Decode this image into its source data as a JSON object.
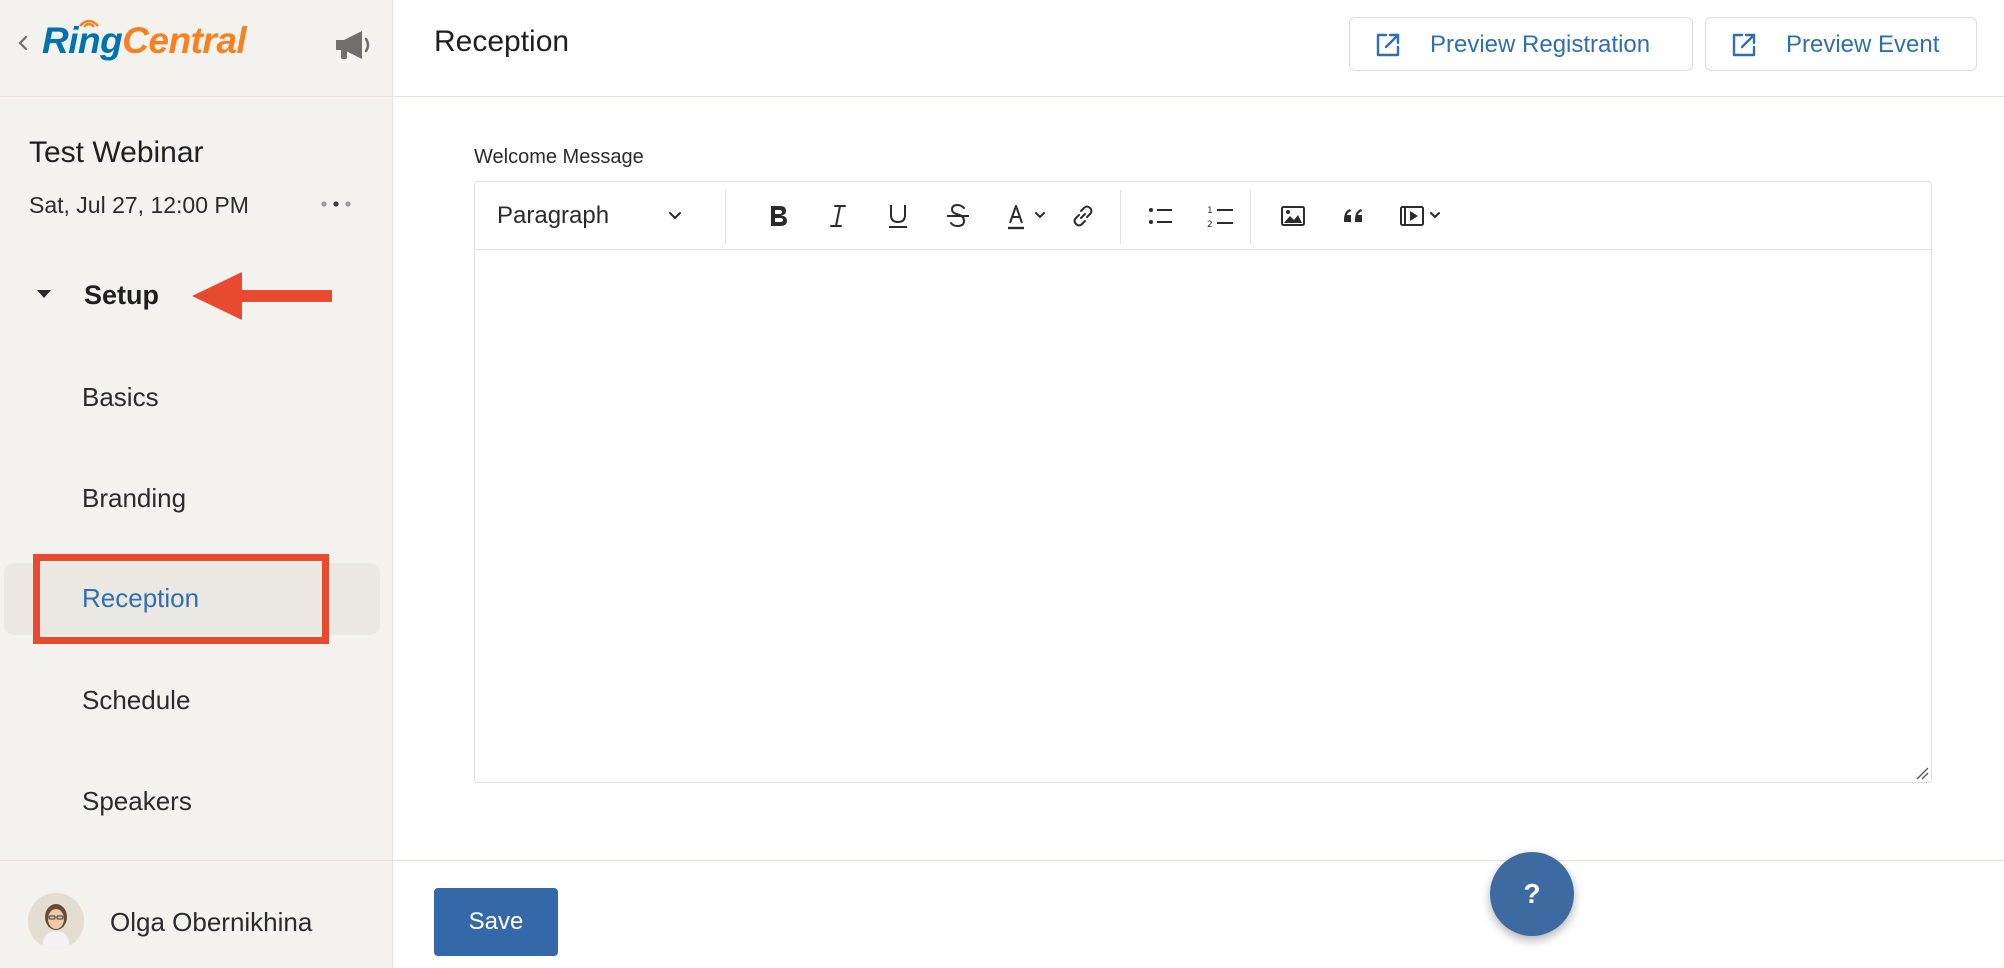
{
  "brand": {
    "logo_ring": "Ring",
    "logo_central": "Central"
  },
  "event": {
    "title": "Test Webinar",
    "date": "Sat, Jul 27, 12:00 PM"
  },
  "nav": {
    "section_label": "Setup",
    "items": [
      {
        "label": "Basics",
        "active": false
      },
      {
        "label": "Branding",
        "active": false
      },
      {
        "label": "Reception",
        "active": true
      },
      {
        "label": "Schedule",
        "active": false
      },
      {
        "label": "Speakers",
        "active": false
      }
    ]
  },
  "user": {
    "name": "Olga Obernikhina"
  },
  "header": {
    "title": "Reception",
    "preview_registration": "Preview Registration",
    "preview_event": "Preview Event"
  },
  "editor": {
    "label": "Welcome Message",
    "block_format": "Paragraph",
    "content": ""
  },
  "footer": {
    "save_label": "Save"
  },
  "help": {
    "label": "?"
  },
  "colors": {
    "accent": "#2f6fb1",
    "primary_button": "#3568a8",
    "annotation": "#e84a2f",
    "sidebar_bg": "#f4f2ef"
  }
}
